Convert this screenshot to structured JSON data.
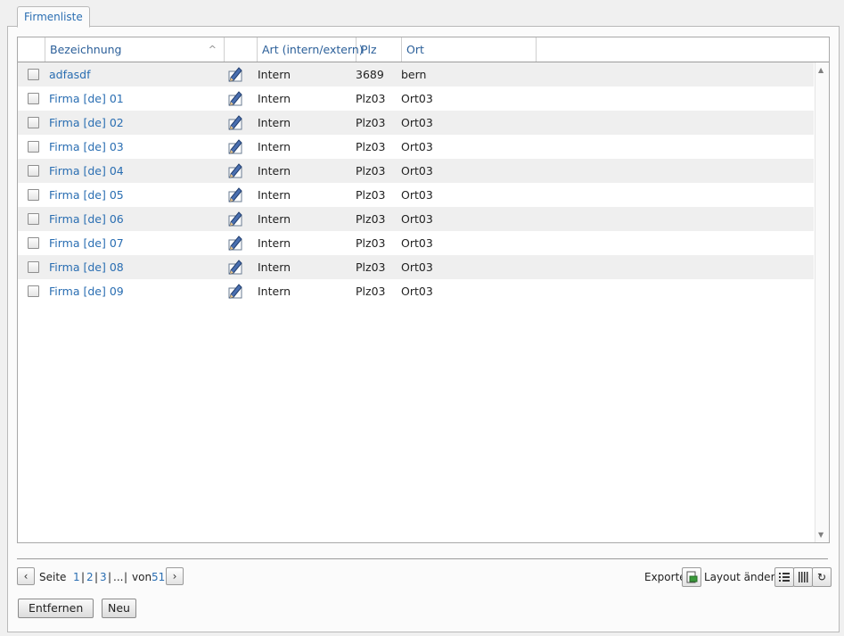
{
  "tab": {
    "label": "Firmenliste"
  },
  "grid": {
    "columns": {
      "bezeichnung": "Bezeichnung",
      "art": "Art (intern/extern)",
      "plz": "Plz",
      "ort": "Ort"
    },
    "rows": [
      {
        "name": "adfasdf",
        "art": "Intern",
        "plz": "3689",
        "ort": "bern"
      },
      {
        "name": "Firma [de] 01",
        "art": "Intern",
        "plz": "Plz03",
        "ort": "Ort03"
      },
      {
        "name": "Firma [de] 02",
        "art": "Intern",
        "plz": "Plz03",
        "ort": "Ort03"
      },
      {
        "name": "Firma [de] 03",
        "art": "Intern",
        "plz": "Plz03",
        "ort": "Ort03"
      },
      {
        "name": "Firma [de] 04",
        "art": "Intern",
        "plz": "Plz03",
        "ort": "Ort03"
      },
      {
        "name": "Firma [de] 05",
        "art": "Intern",
        "plz": "Plz03",
        "ort": "Ort03"
      },
      {
        "name": "Firma [de] 06",
        "art": "Intern",
        "plz": "Plz03",
        "ort": "Ort03"
      },
      {
        "name": "Firma [de] 07",
        "art": "Intern",
        "plz": "Plz03",
        "ort": "Ort03"
      },
      {
        "name": "Firma [de] 08",
        "art": "Intern",
        "plz": "Plz03",
        "ort": "Ort03"
      },
      {
        "name": "Firma [de] 09",
        "art": "Intern",
        "plz": "Plz03",
        "ort": "Ort03"
      }
    ]
  },
  "pager": {
    "seite": "Seite",
    "pages": [
      "1",
      "2",
      "3"
    ],
    "ellipsis": "...",
    "von": "von",
    "total": "51"
  },
  "tools": {
    "exporte": "Exporte",
    "layout": "Layout ändern"
  },
  "buttons": {
    "entfernen": "Entfernen",
    "neu": "Neu"
  },
  "colors": {
    "link": "#2a6eb2",
    "row_alt": "#efefef"
  },
  "icons": [
    "edit-pencil-icon",
    "chevron-left-icon",
    "chevron-right-icon",
    "export-icon",
    "list-view-icon",
    "columns-view-icon",
    "refresh-icon",
    "sort-ascending-icon",
    "checkbox"
  ]
}
